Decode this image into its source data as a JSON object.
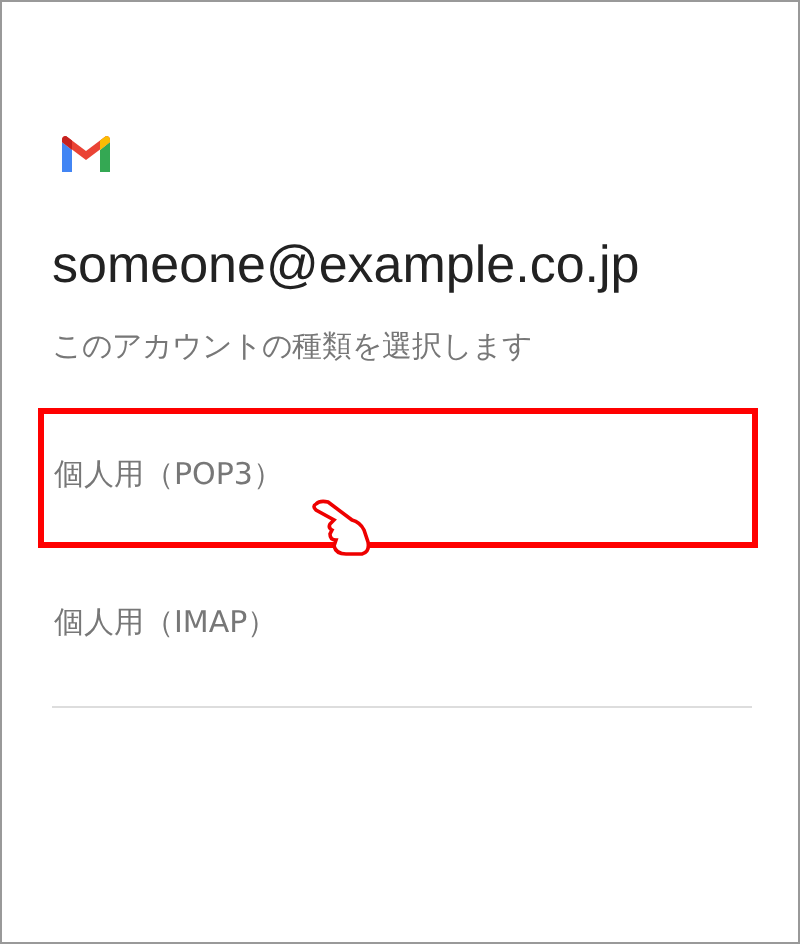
{
  "account": {
    "email": "someone@example.co.jp",
    "prompt": "このアカウントの種類を選択します"
  },
  "options": [
    {
      "label": "個人用（POP3）",
      "highlighted": true
    },
    {
      "label": "個人用（IMAP）",
      "highlighted": false
    }
  ]
}
